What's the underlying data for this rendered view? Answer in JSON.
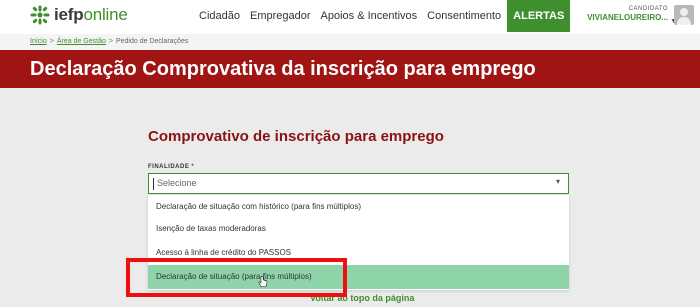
{
  "brand": {
    "part1": "iefp",
    "part2": "online"
  },
  "nav": {
    "items": [
      "Cidadão",
      "Empregador",
      "Apoios & Incentivos",
      "Consentimento"
    ],
    "alert": "ALERTAS"
  },
  "user": {
    "role": "CANDIDATO",
    "name": "VIVIANELOUREIRO..."
  },
  "breadcrumb": {
    "home": "Início",
    "area": "Área de Gestão",
    "current": "Pedido de Declarações",
    "separator": ">"
  },
  "page_title": "Declaração Comprovativa da inscrição para emprego",
  "form": {
    "title": "Comprovativo de inscrição para emprego",
    "label": "FINALIDADE",
    "required_mark": "*",
    "placeholder": "Selecione",
    "options": [
      "Declaração de situação com histórico (para fins múltiplos)",
      "Isenção de taxas moderadoras",
      "Acesso à linha de crédito do PASSOS",
      "Declaração de situação (para fins múltiplos)"
    ],
    "selected_index": 3
  },
  "back_to_top": "Voltar ao topo da página",
  "colors": {
    "brand_green": "#3f8f2f",
    "title_red": "#a01414",
    "highlight": "#ee0f0f",
    "selected_option": "#8fd4a8"
  }
}
